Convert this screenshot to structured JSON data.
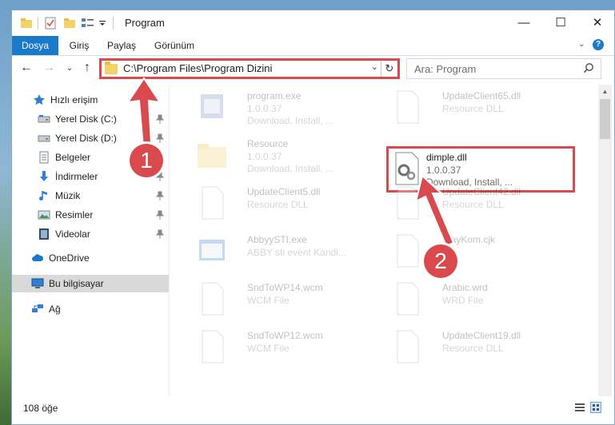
{
  "window": {
    "title": "Program",
    "controls": {
      "minimize": "—",
      "maximize": "☐",
      "close": "✕"
    }
  },
  "ribbon": {
    "tabs": [
      {
        "label": "Dosya",
        "active": true
      },
      {
        "label": "Giriş"
      },
      {
        "label": "Paylaş"
      },
      {
        "label": "Görünüm"
      }
    ],
    "help": "?"
  },
  "nav": {
    "address": "C:\\Program Files\\Program Dizini",
    "search_placeholder": "Ara: Program"
  },
  "sidebar": {
    "items": [
      {
        "label": "Hızlı erişim",
        "icon": "star-icon",
        "pinned": false
      },
      {
        "label": "Yerel Disk (C:)",
        "icon": "drive-icon",
        "pinned": true
      },
      {
        "label": "Yerel Disk (D:)",
        "icon": "drive-icon",
        "pinned": true
      },
      {
        "label": "Belgeler",
        "icon": "documents-icon",
        "pinned": true
      },
      {
        "label": "İndirmeler",
        "icon": "download-icon",
        "pinned": true
      },
      {
        "label": "Müzik",
        "icon": "music-icon",
        "pinned": true
      },
      {
        "label": "Resimler",
        "icon": "pictures-icon",
        "pinned": true
      },
      {
        "label": "Videolar",
        "icon": "videos-icon",
        "pinned": true
      },
      {
        "label": "OneDrive",
        "icon": "cloud-icon"
      },
      {
        "label": "Bu bilgisayar",
        "icon": "computer-icon",
        "selected": true
      },
      {
        "label": "Ağ",
        "icon": "network-icon"
      }
    ]
  },
  "files": [
    {
      "name": "program.exe",
      "line1": "1.0.0.37",
      "line2": "Download, Install, ...",
      "icon": "exe-icon",
      "faded": true
    },
    {
      "name": "UpdateClient65.dll",
      "line1": "Resource DLL",
      "line2": "",
      "icon": "dll-file-icon",
      "faded": true
    },
    {
      "name": "Resource",
      "line1": "1.0.0.37",
      "line2": "Download, Install, ...",
      "icon": "folder-icon",
      "faded": true
    },
    {
      "name": "dimple.dll",
      "line1": "1.0.0.37",
      "line2": "Download, Install, ...",
      "icon": "dll-gear-icon",
      "faded": false,
      "highlighted": true
    },
    {
      "name": "UpdateClient5.dll",
      "line1": "Resource DLL",
      "line2": "",
      "icon": "dll-file-icon",
      "faded": true
    },
    {
      "name": "UpdateClient42.dll",
      "line1": "Resource DLL",
      "line2": "",
      "icon": "dll-file-icon",
      "faded": true
    },
    {
      "name": "AbbyySTI.exe",
      "line1": "ABBY sti event Kandi...",
      "line2": "",
      "icon": "exe-window-icon",
      "faded": true
    },
    {
      "name": "PlayKom.cjk",
      "line1": "File",
      "line2": "",
      "icon": "generic-file-icon",
      "faded": true
    },
    {
      "name": "SndToWP14.wcm",
      "line1": "WCM File",
      "line2": "",
      "icon": "generic-file-icon",
      "faded": true
    },
    {
      "name": "Arabic.wrd",
      "line1": "WRD File",
      "line2": "",
      "icon": "generic-file-icon",
      "faded": true
    },
    {
      "name": "SndToWP12.wcm",
      "line1": "WCM File",
      "line2": "",
      "icon": "generic-file-icon",
      "faded": true
    },
    {
      "name": "UpdateClient19.dll",
      "line1": "Resource DLL",
      "line2": "",
      "icon": "dll-file-icon",
      "faded": true
    }
  ],
  "status": {
    "count": "108 öğe"
  },
  "annotations": [
    {
      "number": "1"
    },
    {
      "number": "2"
    }
  ],
  "colors": {
    "accent": "#1979ca",
    "annotation": "#d84a4e",
    "folder": "#f3d266"
  }
}
